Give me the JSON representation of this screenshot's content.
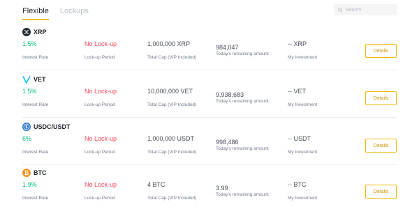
{
  "tabs": [
    {
      "label": "Flexible"
    },
    {
      "label": "Lockups"
    }
  ],
  "search": {
    "placeholder": "Search"
  },
  "labels": {
    "interest_rate": "Interest Rate",
    "lockup_period": "Lock-up Period",
    "total_cap": "Total Cap (VIP Included)",
    "remaining": "Today's remaining amount",
    "investment": "My Investment",
    "details": "Details"
  },
  "products": [
    {
      "name": "XRP",
      "icon": "xrp-icon",
      "rate": "1.5%",
      "lockup": "No Lock-up",
      "cap": "1,000,000 XRP",
      "remaining": "984,047",
      "investment": "-- XRP"
    },
    {
      "name": "VET",
      "icon": "vet-icon",
      "rate": "1.5%",
      "lockup": "No Lock-up",
      "cap": "10,000,000 VET",
      "remaining": "9,938,683",
      "investment": "-- VET"
    },
    {
      "name": "USDC/USDT",
      "icon": "usdc-icon",
      "rate": "6%",
      "lockup": "No Lock-up",
      "cap": "1,000,000 USDT",
      "remaining": "998,486",
      "investment": "-- USDT"
    },
    {
      "name": "BTC",
      "icon": "btc-icon",
      "rate": "1.9%",
      "lockup": "No Lock-up",
      "cap": "4 BTC",
      "remaining": "3.99",
      "investment": "-- BTC"
    }
  ],
  "colors": {
    "accent": "#f0b90b",
    "positive": "#02c076",
    "negative": "#f6465d"
  }
}
